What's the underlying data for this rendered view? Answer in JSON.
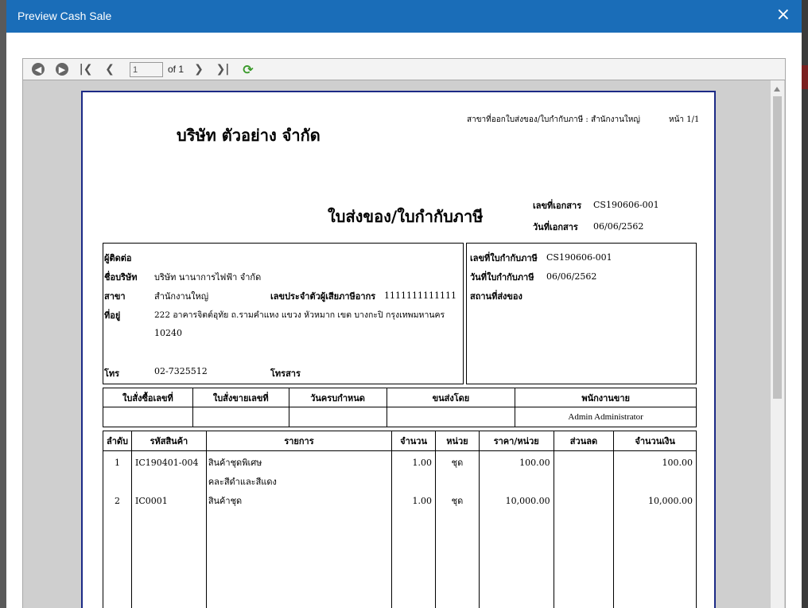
{
  "dialog": {
    "title": "Preview Cash Sale",
    "close_icon": "×"
  },
  "toolbar": {
    "page_value": "1",
    "of_label": "of 1"
  },
  "doc": {
    "branch_label": "สาขาที่ออกใบส่งของ/ใบกำกับภาษี : สำนักงานใหญ่",
    "page_label": "หน้า 1/1",
    "company": "บริษัท ตัวอย่าง จำกัด",
    "doc_title": "ใบส่งของ/ใบกำกับภาษี",
    "docno_label": "เลขที่เอกสาร",
    "docno_value": "CS190606-001",
    "docdate_label": "วันที่เอกสาร",
    "docdate_value": "06/06/2562",
    "contact_label": "ผู้ติดต่อ",
    "company_name_label": "ชื่อบริษัท",
    "company_name_value": "บริษัท นานาการไฟฟ้า จำกัด",
    "branch2_label": "สาขา",
    "branch2_value": "สำนักงานใหญ่",
    "taxid_label": "เลขประจำตัวผู้เสียภาษีอากร",
    "taxid_value": "1111111111111",
    "address_label": "ที่อยู่",
    "address_line1": "222 อาคารจิตต์อุทัย ถ.รามคำแหง แขวง หัวหมาก เขต บางกะปิ กรุงเทพมหานคร",
    "address_line2": "10240",
    "phone_label": "โทร",
    "phone_value": "02-7325512",
    "fax_label": "โทรสาร",
    "invno_label": "เลขที่ใบกำกับภาษี",
    "invno_value": "CS190606-001",
    "invdate_label": "วันที่ใบกำกับภาษี",
    "invdate_value": "06/06/2562",
    "ship_label": "สถานที่ส่งของ",
    "info_headers": [
      "ใบสั่งซื้อเลขที่",
      "ใบสั่งขายเลขที่",
      "วันครบกำหนด",
      "ขนส่งโดย",
      "พนักงานขาย"
    ],
    "info_values": [
      "",
      "",
      "",
      "",
      "Admin Administrator"
    ],
    "item_headers": [
      "ลำดับ",
      "รหัสสินค้า",
      "รายการ",
      "จำนวน",
      "หน่วย",
      "ราคา/หน่วย",
      "ส่วนลด",
      "จำนวนเงิน"
    ],
    "items": [
      {
        "no": "1",
        "code": "IC190401-004",
        "desc": "สินค้าชุดพิเศษ",
        "desc2": "คละสีดำและสีแดง",
        "qty": "1.00",
        "unit": "ชุด",
        "price": "100.00",
        "disc": "",
        "amount": "100.00"
      },
      {
        "no": "2",
        "code": "IC0001",
        "desc": "สินค้าชุด",
        "desc2": "",
        "qty": "1.00",
        "unit": "ชุด",
        "price": "10,000.00",
        "disc": "",
        "amount": "10,000.00"
      }
    ]
  }
}
